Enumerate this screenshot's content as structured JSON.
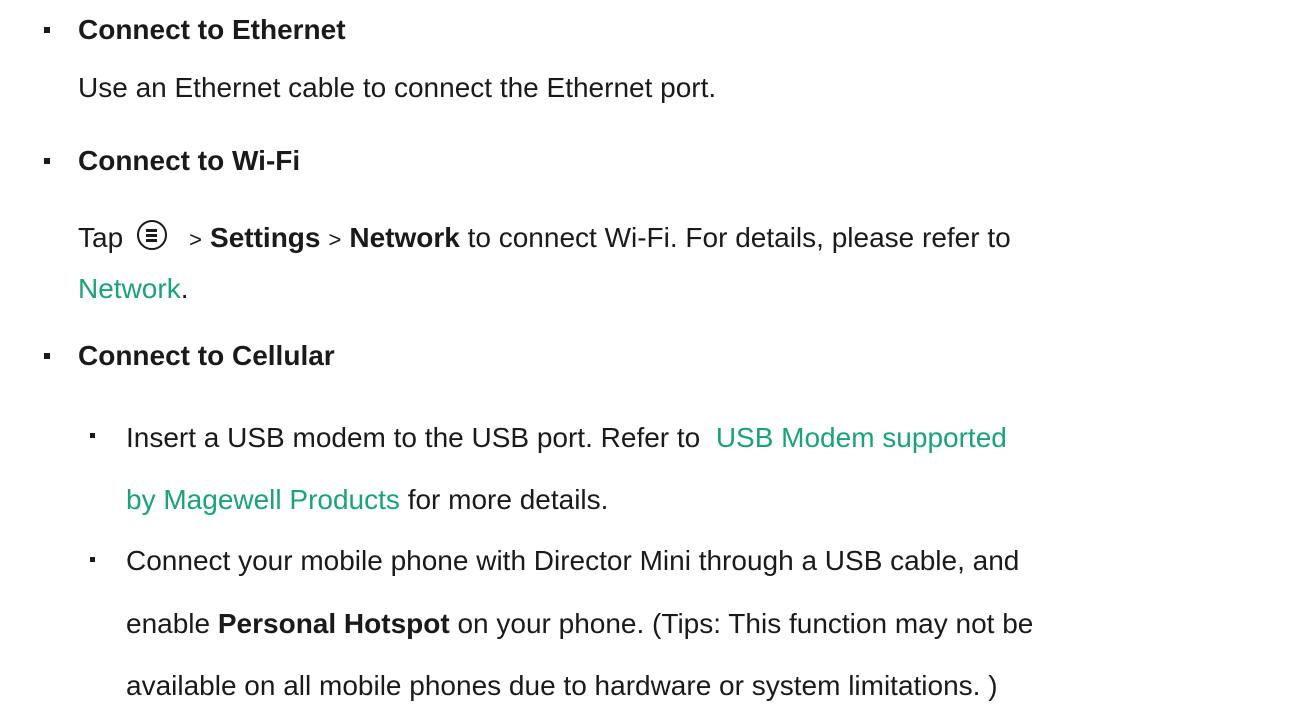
{
  "sections": [
    {
      "heading": "Connect to Ethernet",
      "body": "Use an Ethernet cable to connect the Ethernet port."
    },
    {
      "heading": "Connect to Wi-Fi",
      "body_prefix": "Tap",
      "menu_icon": "menu-circle-icon",
      "separator": ">",
      "settings_label": "Settings",
      "network_label": "Network",
      "body_suffix": "to connect Wi-Fi. For details, please refer to",
      "link": "Network",
      "link_suffix": "."
    },
    {
      "heading": "Connect to Cellular",
      "items": [
        {
          "text_prefix": "Insert a USB modem to the USB port. Refer to",
          "link_line1": "USB Modem supported",
          "link_line2": "by Magewell Products",
          "text_suffix": "for more details."
        },
        {
          "line1": "Connect your mobile phone with Director Mini through a USB cable, and",
          "line2_prefix": "enable",
          "line2_bold": "Personal Hotspot",
          "line2_suffix": "on your phone. (Tips: This function may not be",
          "line3": "available on all mobile phones due to hardware or system limitations. )"
        }
      ]
    }
  ],
  "colors": {
    "text": "#1a1a1a",
    "link": "#1aa37a"
  }
}
